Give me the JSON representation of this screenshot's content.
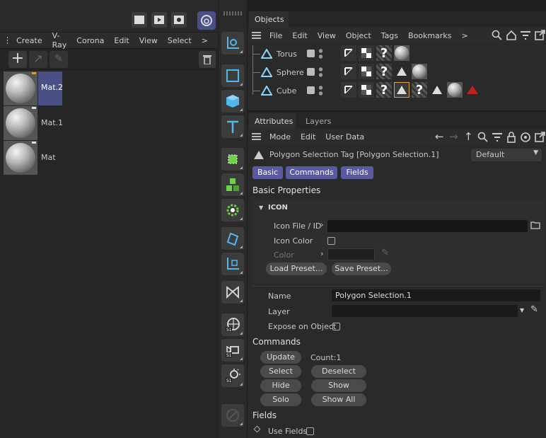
{
  "left_panel": {
    "menu": [
      "Create",
      "V-Ray",
      "Corona",
      "Edit",
      "View",
      "Select"
    ],
    "more": ">",
    "materials": [
      {
        "name": "Mat.2",
        "selected": true
      },
      {
        "name": "Mat.1",
        "selected": false
      },
      {
        "name": "Mat",
        "selected": false
      }
    ]
  },
  "objects_panel": {
    "tab": "Objects",
    "menu": [
      "File",
      "Edit",
      "View",
      "Object",
      "Tags",
      "Bookmarks"
    ],
    "more": ">",
    "rows": [
      {
        "name": "Torus"
      },
      {
        "name": "Sphere"
      },
      {
        "name": "Cube"
      }
    ]
  },
  "attributes_panel": {
    "tabs": [
      "Attributes",
      "Layers"
    ],
    "menu": [
      "Mode",
      "Edit",
      "User Data"
    ],
    "title": "Polygon Selection Tag [Polygon Selection.1]",
    "preset": "Default",
    "sub_tabs": [
      "Basic",
      "Commands",
      "Fields"
    ],
    "basic_properties": "Basic Properties",
    "icon_group": "ICON",
    "icon_file_label": "Icon File / ID",
    "icon_color_label": "Icon Color",
    "color_label": "Color",
    "load_preset": "Load Preset...",
    "save_preset": "Save Preset...",
    "name_label": "Name",
    "name_value": "Polygon Selection.1",
    "layer_label": "Layer",
    "expose_label": "Expose on Object",
    "commands_heading": "Commands",
    "update": "Update",
    "count": "Count:1",
    "select": "Select",
    "deselect": "Deselect",
    "hide": "Hide",
    "show": "Show",
    "solo": "Solo",
    "show_all": "Show All",
    "fields_heading": "Fields",
    "use_fields_label": "Use Fields"
  },
  "colors": {
    "accent": "#5a5aa0",
    "selected": "#4a4f86",
    "warning": "#c0201f"
  }
}
